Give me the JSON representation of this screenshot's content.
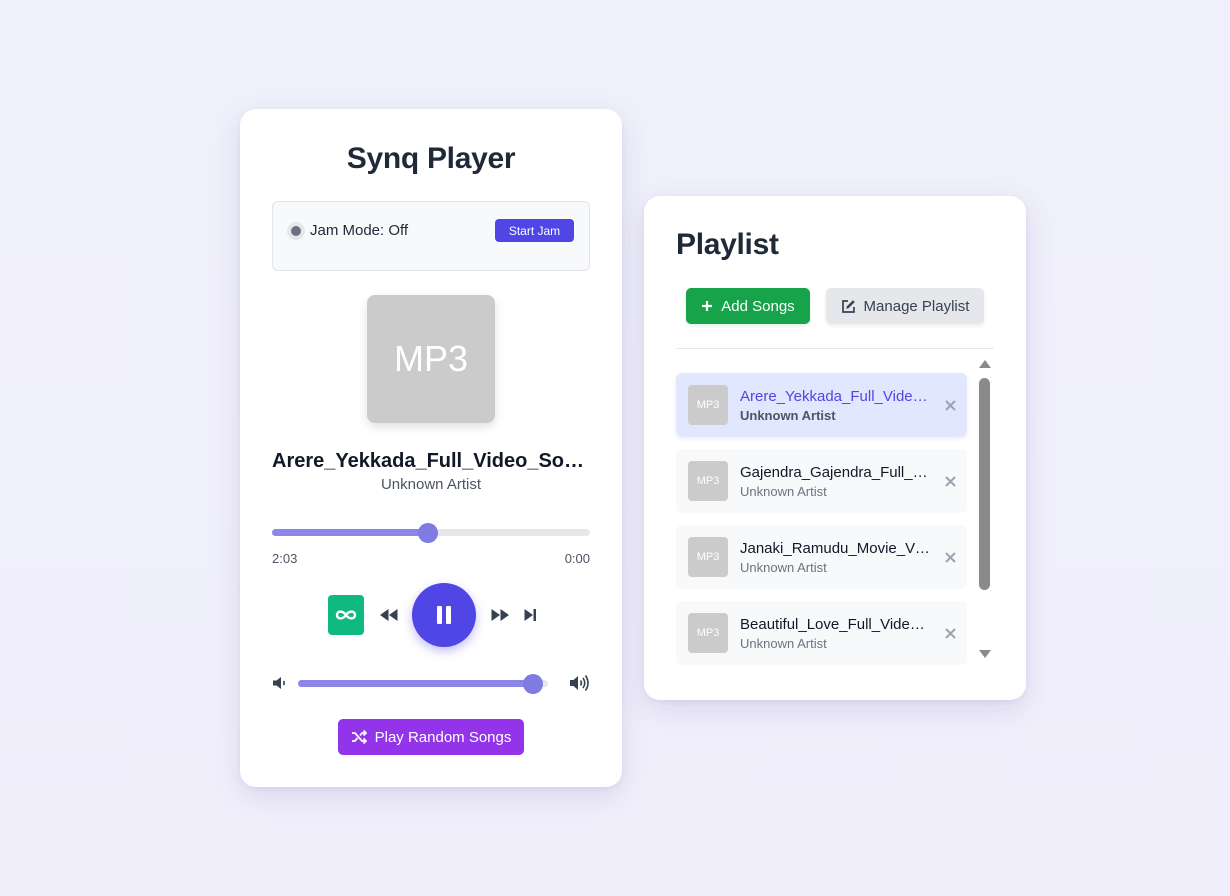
{
  "player": {
    "title": "Synq Player",
    "jam": {
      "status_label": "Jam Mode: Off",
      "button_label": "Start Jam"
    },
    "art_label": "MP3",
    "now_playing": {
      "title": "Arere_Yekkada_Full_Video_Song_",
      "artist": "Unknown Artist"
    },
    "progress": {
      "current_time": "2:03",
      "end_time": "0:00",
      "fraction": 0.49
    },
    "volume": {
      "fraction": 0.94
    },
    "random_button_label": "Play Random Songs",
    "colors": {
      "accent": "#4f46e5",
      "loop": "#10b981",
      "random": "#9333ea",
      "slider": "#8b86e8"
    },
    "icons": [
      "infinity-icon",
      "rewind-icon",
      "pause-icon",
      "fast-forward-icon",
      "skip-next-icon",
      "volume-low-icon",
      "volume-high-icon",
      "shuffle-icon"
    ]
  },
  "playlist": {
    "title": "Playlist",
    "add_label": "Add Songs",
    "manage_label": "Manage Playlist",
    "colors": {
      "add": "#16a34a",
      "active_bg": "#e0e7ff"
    },
    "items": [
      {
        "thumb": "MP3",
        "name": "Arere_Yekkada_Full_Video_Song_",
        "artist": "Unknown Artist",
        "active": true
      },
      {
        "thumb": "MP3",
        "name": "Gajendra_Gajendra_Full_Video_Song",
        "artist": "Unknown Artist",
        "active": false
      },
      {
        "thumb": "MP3",
        "name": "Janaki_Ramudu_Movie_Video_Song",
        "artist": "Unknown Artist",
        "active": false
      },
      {
        "thumb": "MP3",
        "name": "Beautiful_Love_Full_Video_Song",
        "artist": "Unknown Artist",
        "active": false
      }
    ]
  }
}
